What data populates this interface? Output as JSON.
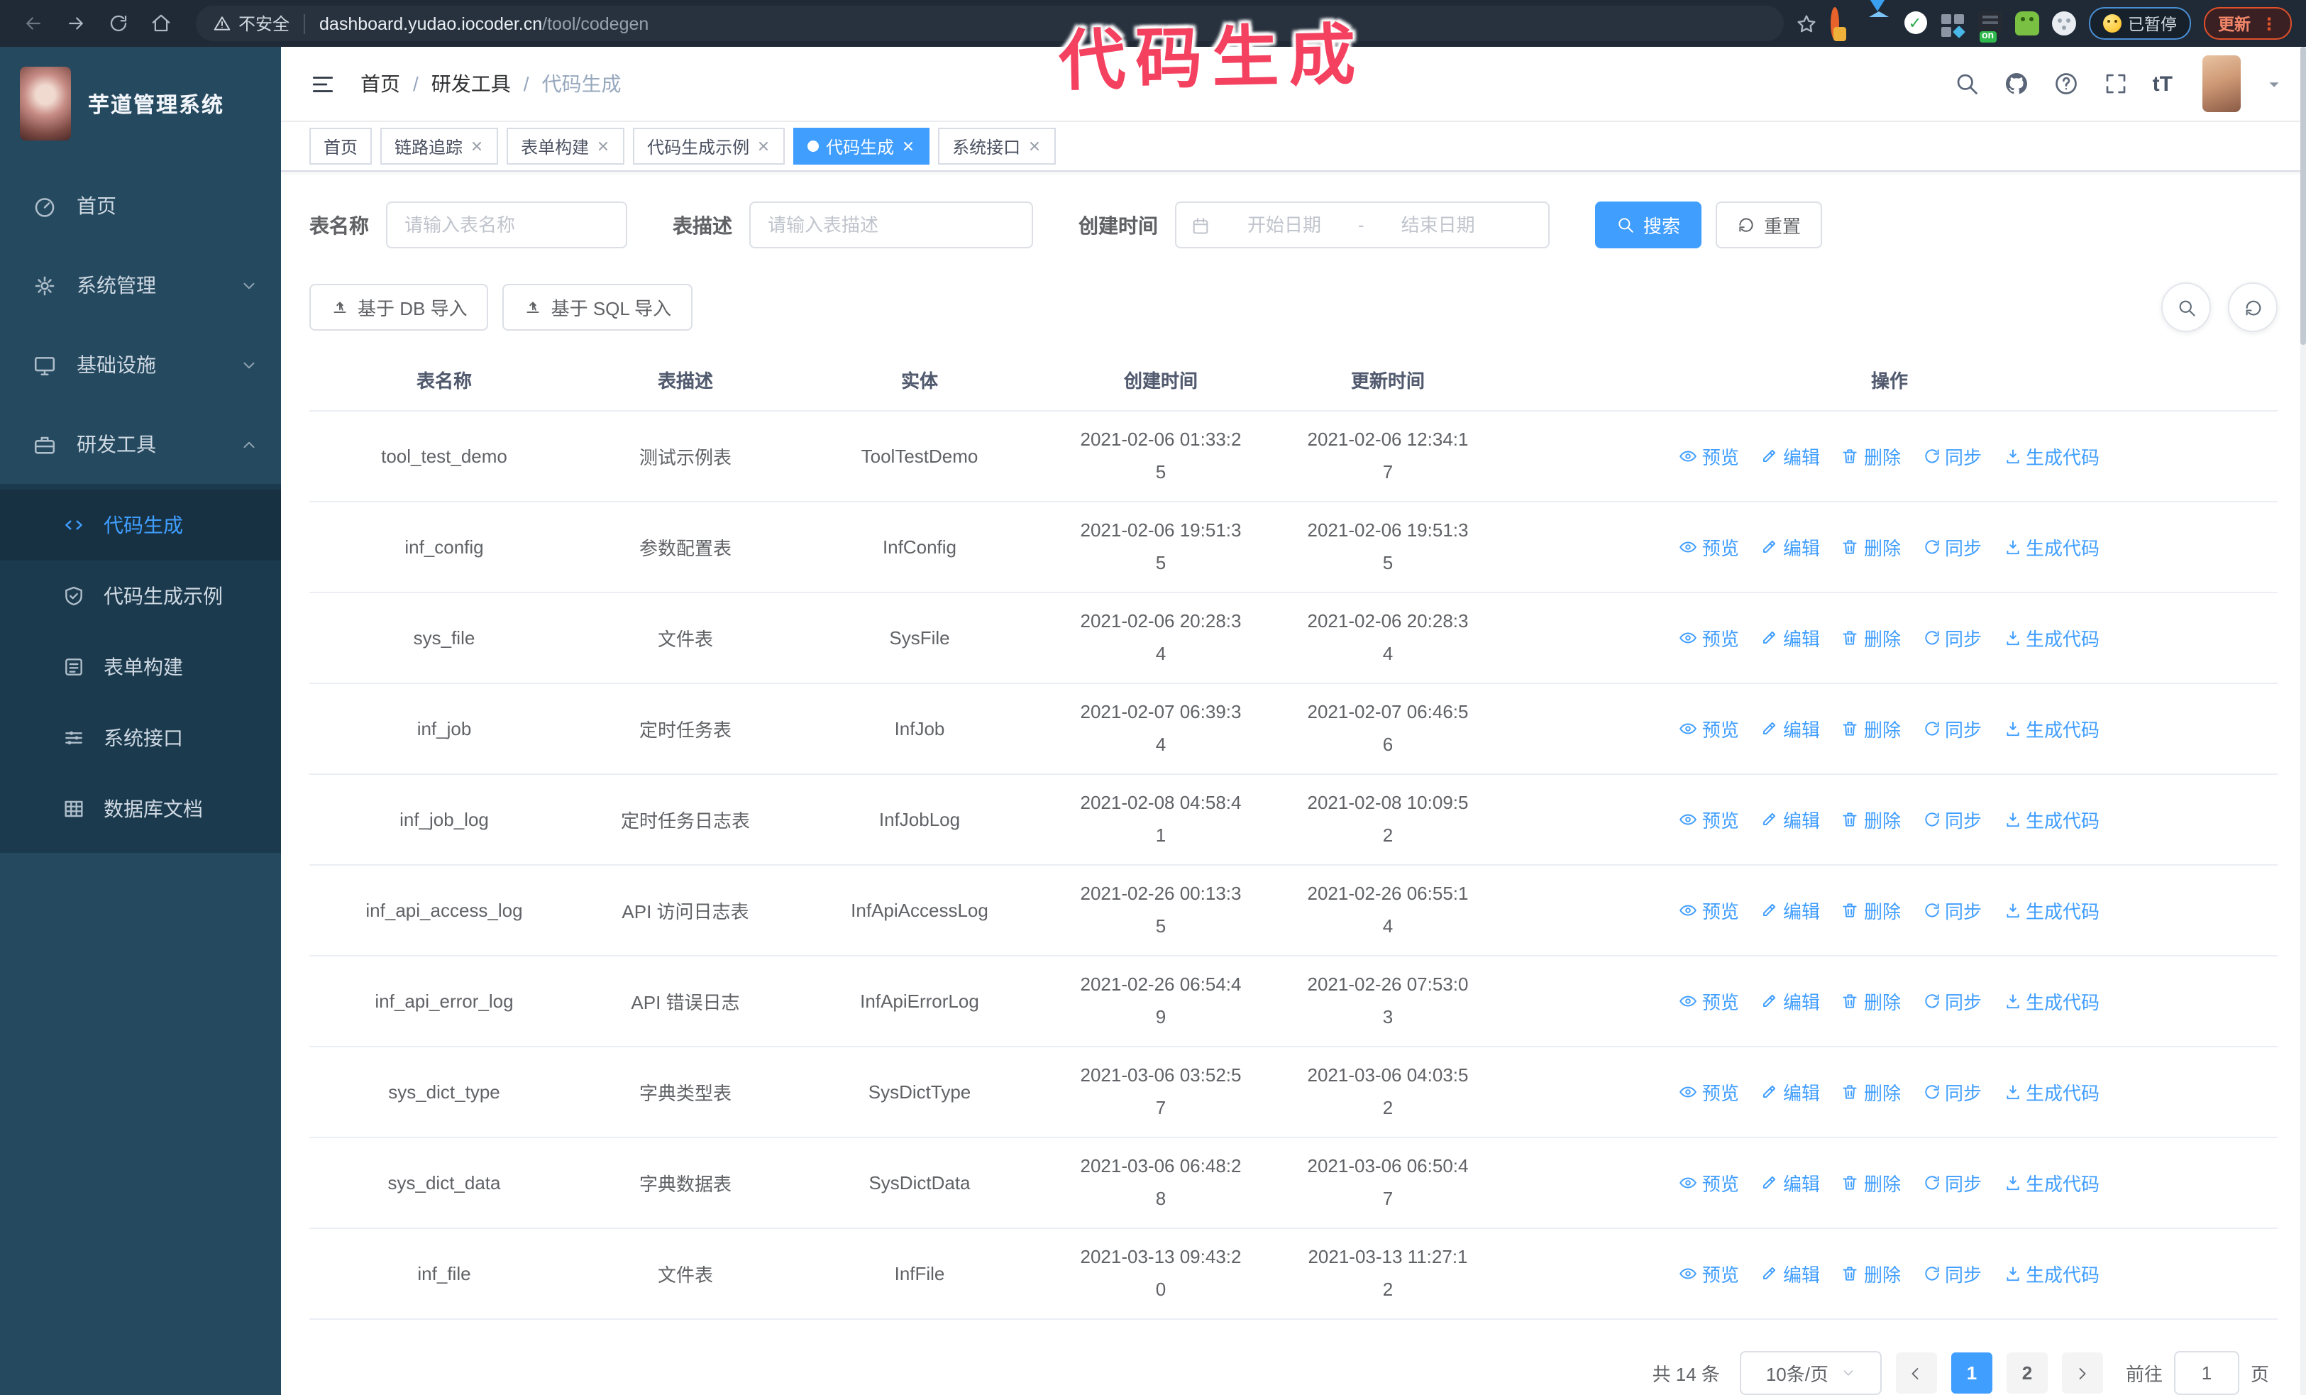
{
  "browser": {
    "security_label": "不安全",
    "url_domain": "dashboard.yudao.iocoder.cn",
    "url_path": "/tool/codegen",
    "paused_badge": "已暂停",
    "update_label": "更新",
    "nav_icons": [
      "back-icon",
      "forward-icon",
      "reload-icon",
      "home-icon"
    ],
    "extension_icons": [
      "orange-ring-extension-icon",
      "blue-gem-extension-icon",
      "green-check-extension-icon",
      "grid-extension-icon",
      "dark-on-extension-icon",
      "green-bot-extension-icon",
      "white-paw-extension-icon"
    ]
  },
  "annotation": {
    "text": "代码生成",
    "color": "#f4415f"
  },
  "sidebar": {
    "title": "芋道管理系统",
    "items": [
      {
        "label": "首页",
        "icon": "dashboard-icon",
        "chevron": "none"
      },
      {
        "label": "系统管理",
        "icon": "gear-icon",
        "chevron": "down"
      },
      {
        "label": "基础设施",
        "icon": "monitor-icon",
        "chevron": "down"
      },
      {
        "label": "研发工具",
        "icon": "toolbox-icon",
        "chevron": "up"
      }
    ],
    "submenu": [
      {
        "label": "代码生成",
        "icon": "code-icon",
        "active": true
      },
      {
        "label": "代码生成示例",
        "icon": "badge-check-icon",
        "active": false
      },
      {
        "label": "表单构建",
        "icon": "form-icon",
        "active": false
      },
      {
        "label": "系统接口",
        "icon": "sliders-icon",
        "active": false
      },
      {
        "label": "数据库文档",
        "icon": "table-grid-icon",
        "active": false
      }
    ]
  },
  "header": {
    "breadcrumb": [
      "首页",
      "研发工具",
      "代码生成"
    ],
    "icon_names": [
      "search-icon",
      "github-icon",
      "question-icon",
      "fullscreen-icon",
      "font-size-icon",
      "avatar",
      "caret-down-icon"
    ],
    "font_size_glyph": "tT"
  },
  "tabs": [
    {
      "label": "首页",
      "closable": false,
      "active": false
    },
    {
      "label": "链路追踪",
      "closable": true,
      "active": false
    },
    {
      "label": "表单构建",
      "closable": true,
      "active": false
    },
    {
      "label": "代码生成示例",
      "closable": true,
      "active": false
    },
    {
      "label": "代码生成",
      "closable": true,
      "active": true
    },
    {
      "label": "系统接口",
      "closable": true,
      "active": false
    }
  ],
  "search": {
    "name_label": "表名称",
    "name_placeholder": "请输入表名称",
    "desc_label": "表描述",
    "desc_placeholder": "请输入表描述",
    "time_label": "创建时间",
    "start_placeholder": "开始日期",
    "range_separator": "-",
    "end_placeholder": "结束日期",
    "search_label": "搜索",
    "reset_label": "重置"
  },
  "toolbar": {
    "import_db_label": "基于 DB 导入",
    "import_sql_label": "基于 SQL 导入",
    "corner_icons": [
      "search-icon",
      "refresh-icon"
    ]
  },
  "table": {
    "columns": [
      "表名称",
      "表描述",
      "实体",
      "创建时间",
      "更新时间",
      "操作"
    ],
    "action_labels": [
      "预览",
      "编辑",
      "删除",
      "同步",
      "生成代码"
    ],
    "action_icons": [
      "eye-icon",
      "edit-icon",
      "delete-icon",
      "sync-icon",
      "download-icon"
    ],
    "rows": [
      {
        "name": "tool_test_demo",
        "desc": "测试示例表",
        "entity": "ToolTestDemo",
        "created": "2021-02-06 01:33:25",
        "updated": "2021-02-06 12:34:17"
      },
      {
        "name": "inf_config",
        "desc": "参数配置表",
        "entity": "InfConfig",
        "created": "2021-02-06 19:51:35",
        "updated": "2021-02-06 19:51:35"
      },
      {
        "name": "sys_file",
        "desc": "文件表",
        "entity": "SysFile",
        "created": "2021-02-06 20:28:34",
        "updated": "2021-02-06 20:28:34"
      },
      {
        "name": "inf_job",
        "desc": "定时任务表",
        "entity": "InfJob",
        "created": "2021-02-07 06:39:34",
        "updated": "2021-02-07 06:46:56"
      },
      {
        "name": "inf_job_log",
        "desc": "定时任务日志表",
        "entity": "InfJobLog",
        "created": "2021-02-08 04:58:41",
        "updated": "2021-02-08 10:09:52"
      },
      {
        "name": "inf_api_access_log",
        "desc": "API 访问日志表",
        "entity": "InfApiAccessLog",
        "created": "2021-02-26 00:13:35",
        "updated": "2021-02-26 06:55:14"
      },
      {
        "name": "inf_api_error_log",
        "desc": "API 错误日志",
        "entity": "InfApiErrorLog",
        "created": "2021-02-26 06:54:49",
        "updated": "2021-02-26 07:53:03"
      },
      {
        "name": "sys_dict_type",
        "desc": "字典类型表",
        "entity": "SysDictType",
        "created": "2021-03-06 03:52:57",
        "updated": "2021-03-06 04:03:52"
      },
      {
        "name": "sys_dict_data",
        "desc": "字典数据表",
        "entity": "SysDictData",
        "created": "2021-03-06 06:48:28",
        "updated": "2021-03-06 06:50:47"
      },
      {
        "name": "inf_file",
        "desc": "文件表",
        "entity": "InfFile",
        "created": "2021-03-13 09:43:20",
        "updated": "2021-03-13 11:27:12"
      }
    ]
  },
  "pagination": {
    "total_label": "共 14 条",
    "page_size_label": "10条/页",
    "pages": [
      "1",
      "2"
    ],
    "active_page": "1",
    "goto_label": "前往",
    "goto_value": "1",
    "page_suffix": "页"
  },
  "colors": {
    "accent": "#409eff",
    "annotation": "#f4415f",
    "sidebar_bg": "#25495f",
    "submenu_bg": "#1c3a4e",
    "browser_bar_bg": "#1f2a36",
    "update_button": "#e0502a"
  }
}
